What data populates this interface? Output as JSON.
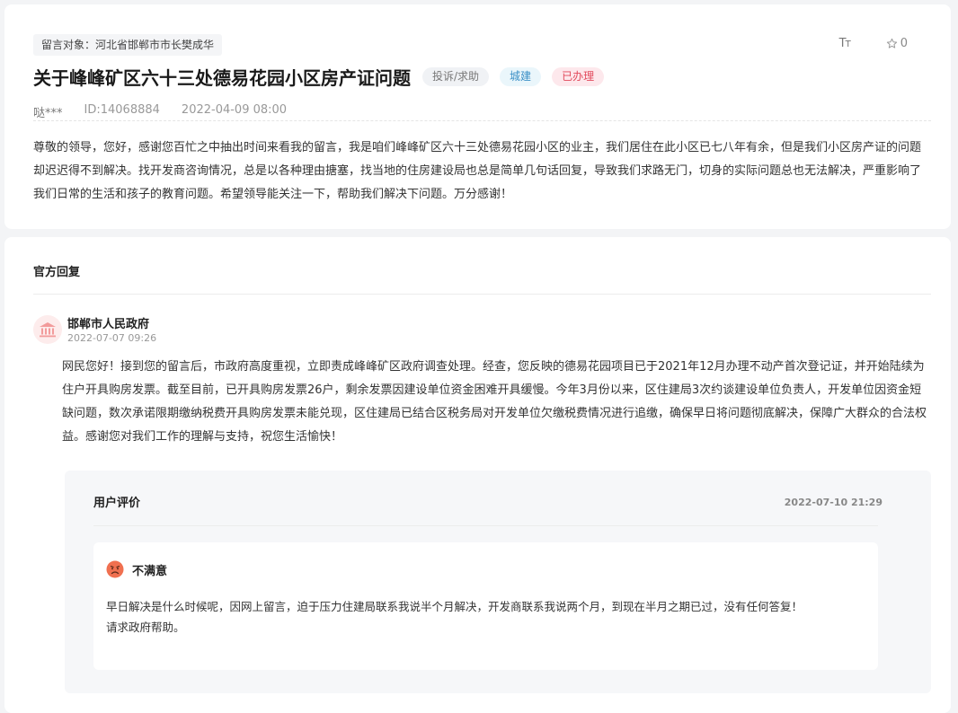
{
  "message": {
    "target_label": "留言对象：河北省邯郸市市长樊成华",
    "font_tool_icon": "font-size-icon",
    "favorite_count": "0",
    "title": "关于峰峰矿区六十三处德易花园小区房产证问题",
    "tags": {
      "type": "投诉/求助",
      "area": "城建",
      "status": "已办理"
    },
    "user": "哒***",
    "id": "ID:14068884",
    "time": "2022-04-09 08:00",
    "content": "尊敬的领导，您好，感谢您百忙之中抽出时间来看我的留言，我是咱们峰峰矿区六十三处德易花园小区的业主，我们居住在此小区已七八年有余，但是我们小区房产证的问题却迟迟得不到解决。找开发商咨询情况，总是以各种理由搪塞，找当地的住房建设局也总是简单几句话回复，导致我们求路无门，切身的实际问题总也无法解决，严重影响了我们日常的生活和孩子的教育问题。希望领导能关注一下，帮助我们解决下问题。万分感谢！"
  },
  "reply": {
    "section_title": "官方回复",
    "org_name": "邯郸市人民政府",
    "org_time": "2022-07-07 09:26",
    "content": "网民您好！接到您的留言后，市政府高度重视，立即责成峰峰矿区政府调查处理。经查，您反映的德易花园项目已于2021年12月办理不动产首次登记证，并开始陆续为住户开具购房发票。截至目前，已开具购房发票26户，剩余发票因建设单位资金困难开具缓慢。今年3月份以来，区住建局3次约谈建设单位负责人，开发单位因资金短缺问题，数次承诺限期缴纳税费开具购房发票未能兑现，区住建局已结合区税务局对开发单位欠缴税费情况进行追缴，确保早日将问题彻底解决，保障广大群众的合法权益。感谢您对我们工作的理解与支持，祝您生活愉快！"
  },
  "evaluation": {
    "title": "用户评价",
    "time": "2022-07-10 21:29",
    "rating": "不满意",
    "text_line1": "早日解决是什么时候呢，因网上留言，迫于压力住建局联系我说半个月解决，开发商联系我说两个月，到现在半月之期已过，没有任何答复！",
    "text_line2": "请求政府帮助。"
  },
  "colors": {
    "status_red": "#e2495b",
    "area_blue": "#3a8fc6",
    "face_orange": "#f07050"
  }
}
